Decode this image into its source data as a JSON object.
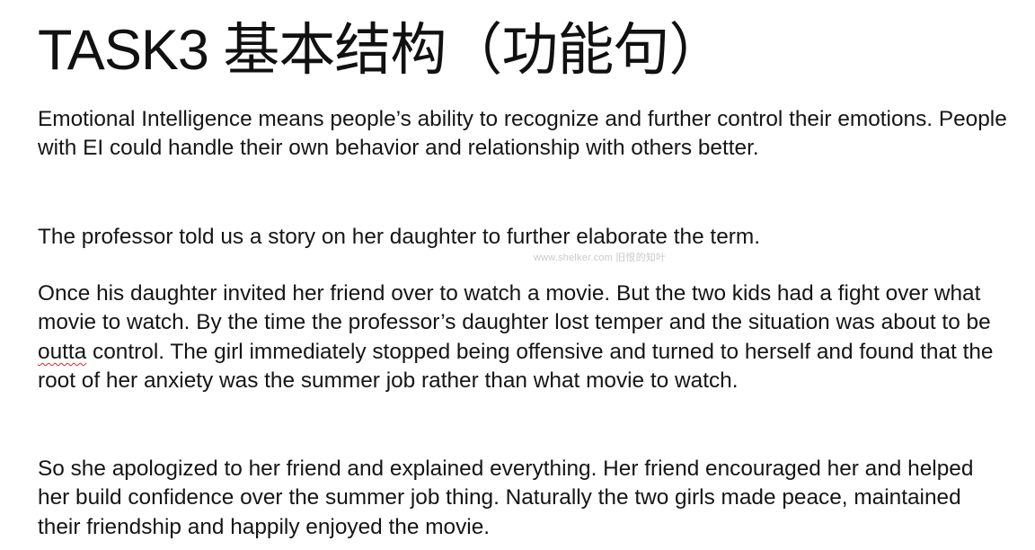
{
  "title": "TASK3 基本结构（功能句）",
  "paragraphs": {
    "p1": "Emotional Intelligence means people’s ability to recognize and further control their emotions. People with EI could handle their own behavior and relationship with others better.",
    "p2": "The professor told us a story on her daughter to further elaborate the term.",
    "p3": {
      "before": "Once his daughter invited her friend over to watch a movie. But the two kids had a fight over what movie to watch. By the time the professor’s daughter lost temper and the situation was about to be ",
      "flagged_word": "outta",
      "after": " control. The girl immediately stopped being offensive and turned to herself and found that the root of her anxiety was the summer job rather than what movie to watch."
    },
    "p4": "So she apologized to her friend and explained everything. Her friend encouraged her and helped her build confidence over the summer job thing. Naturally the two girls made peace, maintained their friendship and happily enjoyed the movie."
  },
  "watermark": "www.shelker.com 旧恨的知叶",
  "colors": {
    "text": "#151515",
    "spellcheck_underline": "#d22c2c",
    "watermark": "#c9c9c9"
  }
}
